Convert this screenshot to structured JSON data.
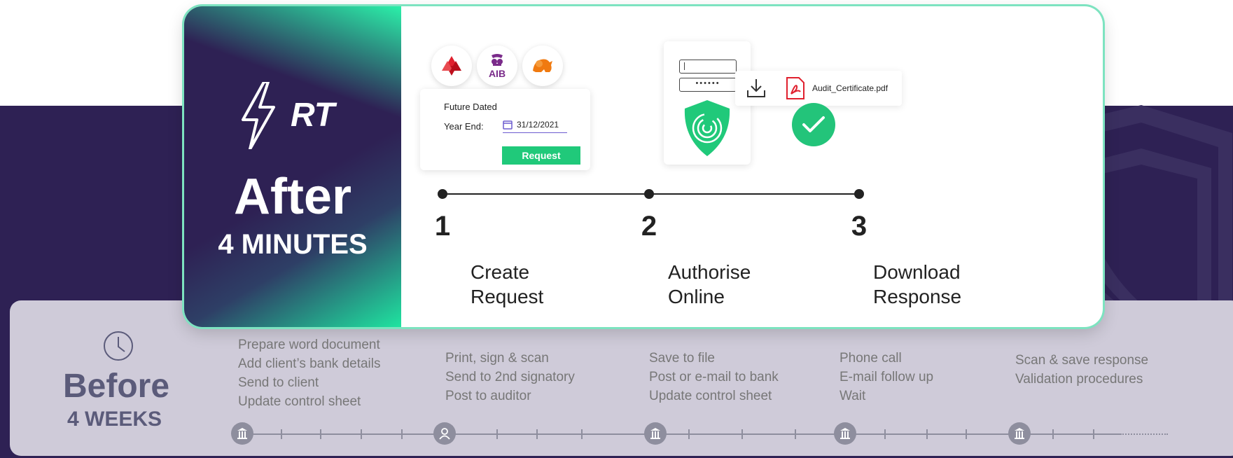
{
  "brand": {
    "rt_label": "RT",
    "accent": "#20c97a",
    "purple": "#2e2154"
  },
  "after": {
    "title": "After",
    "subtitle": "4 MINUTES"
  },
  "banks": [
    {
      "name": "natwest-logo-icon"
    },
    {
      "name": "aib-logo-icon",
      "text": "AIB"
    },
    {
      "name": "ing-lion-logo-icon"
    }
  ],
  "request_form": {
    "title": "Future Dated",
    "year_end_label": "Year End:",
    "year_end_value": "31/12/2021",
    "button_label": "Request"
  },
  "auth": {
    "password_mask": "••••••"
  },
  "download": {
    "filename": "Audit_Certificate.pdf"
  },
  "steps": [
    {
      "number": "1",
      "line1": "Create",
      "line2": "Request"
    },
    {
      "number": "2",
      "line1": "Authorise",
      "line2": "Online"
    },
    {
      "number": "3",
      "line1": "Download",
      "line2": "Response"
    }
  ],
  "before": {
    "title": "Before",
    "subtitle": "4 WEEKS",
    "groups": [
      {
        "tasks": [
          "Prepare word document",
          "Add client’s bank details",
          "Send to client",
          "Update control sheet"
        ]
      },
      {
        "tasks": [
          "Print, sign & scan",
          "Send to 2nd signatory",
          "Post to auditor"
        ]
      },
      {
        "tasks": [
          "Save to file",
          "Post or e-mail to bank",
          "Update control sheet"
        ]
      },
      {
        "tasks": [
          "Phone call",
          "E-mail follow up",
          "Wait"
        ]
      },
      {
        "tasks": [
          "Scan & save response",
          "Validation procedures"
        ]
      }
    ]
  }
}
